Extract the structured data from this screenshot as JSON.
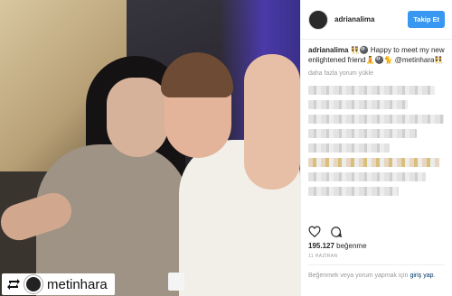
{
  "post": {
    "username": "adrianalima",
    "follow_label": "Takip Et",
    "caption_user": "adrianalima",
    "caption_text": "👯🎱 Happy to meet my new enlightened friend🧘🎱🐈",
    "caption_mention": "@metinhara👯",
    "more_comments": "daha fazla yorum yükle",
    "likes_count": "195.127",
    "likes_label": "beğenme",
    "date": "11 HAZİRAN",
    "login_text": "Beğenmek veya yorum yapmak için ",
    "login_link": "giriş yap",
    "login_suffix": "."
  },
  "repost": {
    "username": "metinhara"
  },
  "icons": {
    "like": "heart-icon",
    "comment": "comment-icon",
    "repost": "repost-icon"
  },
  "colors": {
    "accent": "#3897f0",
    "link": "#003569"
  }
}
